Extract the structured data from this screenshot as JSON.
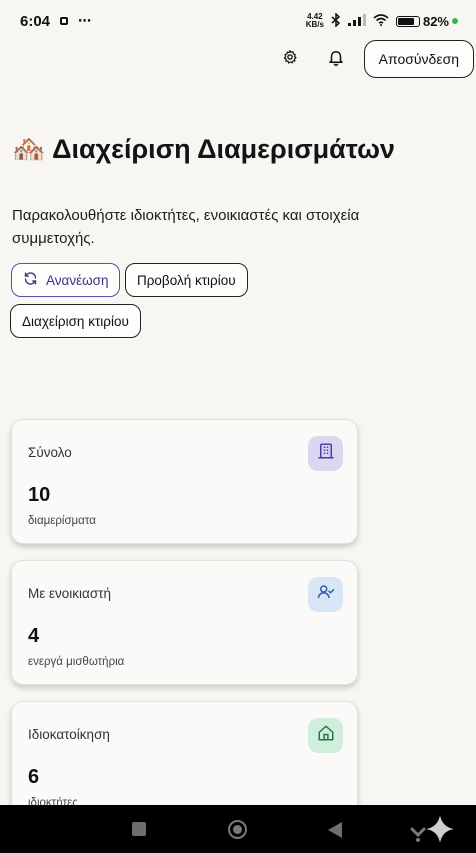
{
  "status_bar": {
    "time": "6:04",
    "more": "⋯",
    "net_speed_value": "4.42",
    "net_speed_unit": "KB/s",
    "battery": "82%"
  },
  "header": {
    "logout_label": "Αποσύνδεση",
    "settings_icon": "gear-icon",
    "notifications_icon": "bell-icon"
  },
  "page": {
    "title": "🏘️ Διαχείριση Διαμερισμάτων",
    "subtitle": "Παρακολουθήστε ιδιοκτήτες, ενοικιαστές και στοιχεία συμμετοχής."
  },
  "actions": {
    "refresh_label": "Ανανέωση",
    "view_building_label": "Προβολή κτιρίου",
    "manage_building_label": "Διαχείριση κτιρίου"
  },
  "stats": [
    {
      "label": "Σύνολο",
      "value": "10",
      "desc": "διαμερίσματα",
      "icon": "building-icon",
      "badge_color": "#ddd6f3",
      "icon_color": "#4a3fa0"
    },
    {
      "label": "Με ενοικιαστή",
      "value": "4",
      "desc": "ενεργά μισθωτήρια",
      "icon": "user-check-icon",
      "badge_color": "#d8e5f7",
      "icon_color": "#2f5fa8"
    },
    {
      "label": "Ιδιοκατοίκηση",
      "value": "6",
      "desc": "ιδιοκτήτες",
      "icon": "home-icon",
      "badge_color": "#cfeedc",
      "icon_color": "#1f7a45"
    }
  ],
  "colors": {
    "background": "#f7f6f3",
    "accent": "#5a4fa8"
  }
}
